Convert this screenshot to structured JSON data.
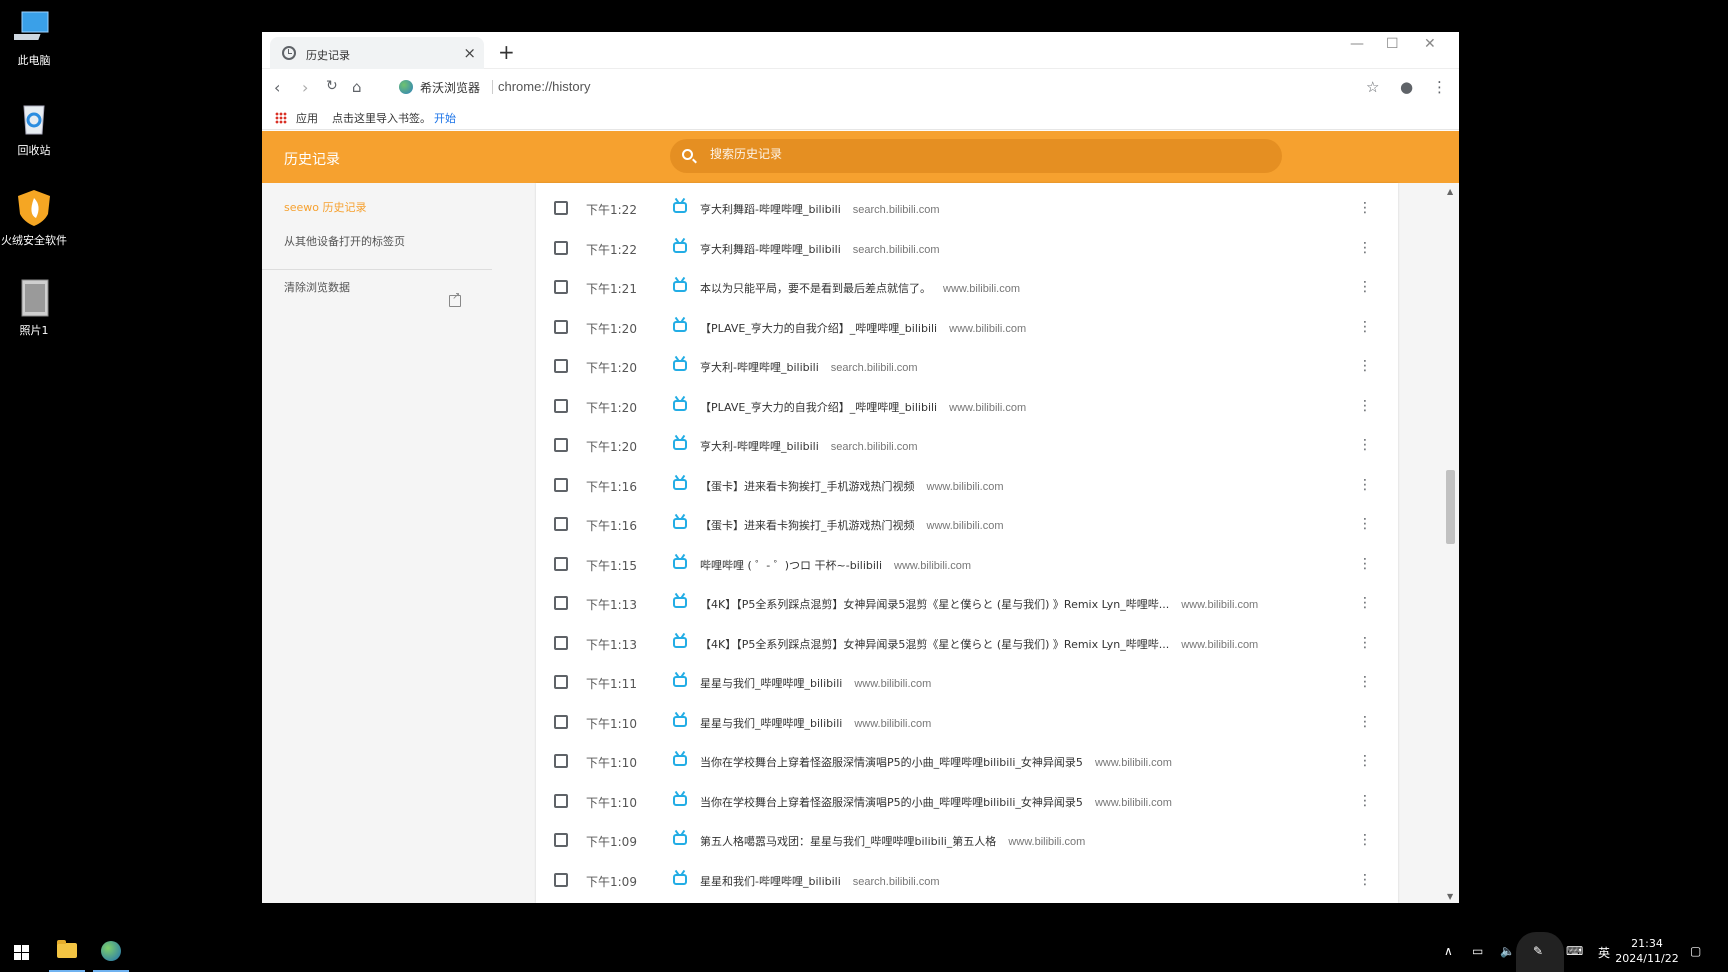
{
  "desktop": {
    "icons": [
      {
        "label": "此电脑",
        "icon": "computer-icon"
      },
      {
        "label": "回收站",
        "icon": "recycle-bin-icon"
      },
      {
        "label": "火绒安全软件",
        "icon": "huorong-shield-icon"
      },
      {
        "label": "照片1",
        "icon": "photo-file-icon"
      }
    ]
  },
  "browser": {
    "tab_title": "历史记录",
    "site_name": "希沃浏览器",
    "url": "chrome://history",
    "bookmarks": {
      "apps": "应用",
      "hint": "点击这里导入书签。",
      "start": "开始"
    }
  },
  "history": {
    "title": "历史记录",
    "search_placeholder": "搜索历史记录",
    "sidebar": {
      "active": "seewo 历史记录",
      "other_devices": "从其他设备打开的标签页",
      "clear": "清除浏览数据"
    },
    "rows": [
      {
        "time": "下午1:22",
        "title": "亨大利舞蹈-哔哩哔哩_bilibili",
        "domain": "search.bilibili.com"
      },
      {
        "time": "下午1:22",
        "title": "亨大利舞蹈-哔哩哔哩_bilibili",
        "domain": "search.bilibili.com"
      },
      {
        "time": "下午1:21",
        "title": "本以为只能平局，要不是看到最后差点就信了。",
        "domain": "www.bilibili.com"
      },
      {
        "time": "下午1:20",
        "title": "【PLAVE_亨大力的自我介绍】_哔哩哔哩_bilibili",
        "domain": "www.bilibili.com"
      },
      {
        "time": "下午1:20",
        "title": "亨大利-哔哩哔哩_bilibili",
        "domain": "search.bilibili.com"
      },
      {
        "time": "下午1:20",
        "title": "【PLAVE_亨大力的自我介绍】_哔哩哔哩_bilibili",
        "domain": "www.bilibili.com"
      },
      {
        "time": "下午1:20",
        "title": "亨大利-哔哩哔哩_bilibili",
        "domain": "search.bilibili.com"
      },
      {
        "time": "下午1:16",
        "title": "【蛋卡】进来看卡狗挨打_手机游戏热门视频",
        "domain": "www.bilibili.com"
      },
      {
        "time": "下午1:16",
        "title": "【蛋卡】进来看卡狗挨打_手机游戏热门视频",
        "domain": "www.bilibili.com"
      },
      {
        "time": "下午1:15",
        "title": "哔哩哔哩 ( ゜- ゜)つロ 干杯~-bilibili",
        "domain": "www.bilibili.com"
      },
      {
        "time": "下午1:13",
        "title": "【4K】【P5全系列踩点混剪】女神异闻录5混剪《星と僕らと (星与我们) 》Remix Lyn_哔哩哔...",
        "domain": "www.bilibili.com"
      },
      {
        "time": "下午1:13",
        "title": "【4K】【P5全系列踩点混剪】女神异闻录5混剪《星と僕らと (星与我们) 》Remix Lyn_哔哩哔...",
        "domain": "www.bilibili.com"
      },
      {
        "time": "下午1:11",
        "title": "星星与我们_哔哩哔哩_bilibili",
        "domain": "www.bilibili.com"
      },
      {
        "time": "下午1:10",
        "title": "星星与我们_哔哩哔哩_bilibili",
        "domain": "www.bilibili.com"
      },
      {
        "time": "下午1:10",
        "title": "当你在学校舞台上穿着怪盗服深情演唱P5的小曲_哔哩哔哩bilibili_女神异闻录5",
        "domain": "www.bilibili.com"
      },
      {
        "time": "下午1:10",
        "title": "当你在学校舞台上穿着怪盗服深情演唱P5的小曲_哔哩哔哩bilibili_女神异闻录5",
        "domain": "www.bilibili.com"
      },
      {
        "time": "下午1:09",
        "title": "第五人格噶嚣马戏团：星星与我们_哔哩哔哩bilibili_第五人格",
        "domain": "www.bilibili.com"
      },
      {
        "time": "下午1:09",
        "title": "星星和我们-哔哩哔哩_bilibili",
        "domain": "search.bilibili.com"
      }
    ]
  },
  "taskbar": {
    "ime": "英",
    "time": "21:34",
    "date": "2024/11/22"
  },
  "colors": {
    "accent": "#f6a12f",
    "favicon": "#23ade5",
    "link": "#1a73e8"
  }
}
